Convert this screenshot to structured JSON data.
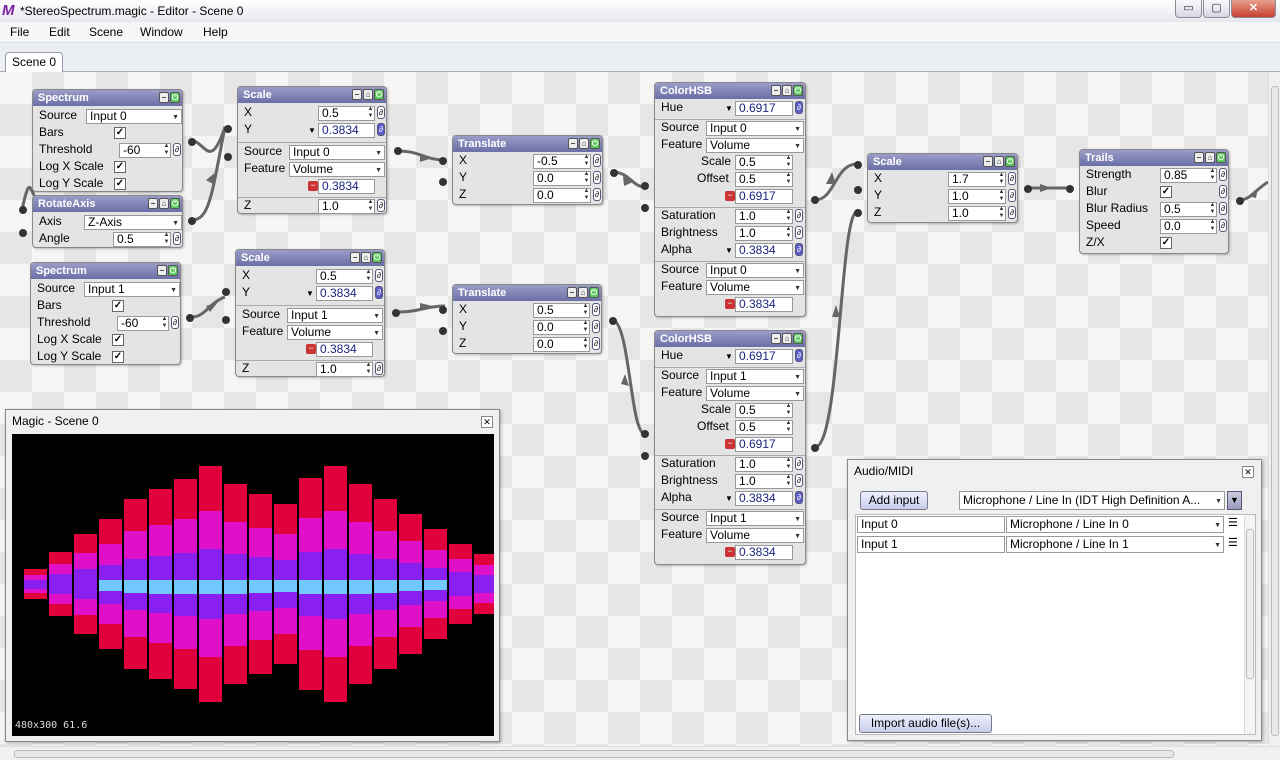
{
  "window": {
    "app_icon": "M",
    "title": "*StereoSpectrum.magic - Editor - Scene 0",
    "min_icon": "▭",
    "max_icon": "▢",
    "close_icon": "✕"
  },
  "menu": [
    "File",
    "Edit",
    "Scene",
    "Window",
    "Help"
  ],
  "tab": "Scene 0",
  "nodes": {
    "spectrum0": {
      "title": "Spectrum",
      "source_label": "Source",
      "source": "Input 0",
      "bars_label": "Bars",
      "threshold_label": "Threshold",
      "threshold": "-60",
      "logx_label": "Log X Scale",
      "logy_label": "Log Y Scale"
    },
    "rotate": {
      "title": "RotateAxis",
      "axis_label": "Axis",
      "axis": "Z-Axis",
      "angle_label": "Angle",
      "angle": "0.5"
    },
    "spectrum1": {
      "title": "Spectrum",
      "source_label": "Source",
      "source": "Input 1",
      "bars_label": "Bars",
      "threshold_label": "Threshold",
      "threshold": "-60",
      "logx_label": "Log X Scale",
      "logy_label": "Log Y Scale"
    },
    "scale0": {
      "title": "Scale",
      "x_label": "X",
      "x": "0.5",
      "y_label": "Y",
      "y": "0.3834",
      "source_label": "Source",
      "source": "Input 0",
      "feature_label": "Feature",
      "feature": "Volume",
      "value": "0.3834",
      "z_label": "Z",
      "z": "1.0"
    },
    "scale1": {
      "title": "Scale",
      "x_label": "X",
      "x": "0.5",
      "y_label": "Y",
      "y": "0.3834",
      "source_label": "Source",
      "source": "Input 1",
      "feature_label": "Feature",
      "feature": "Volume",
      "value": "0.3834",
      "z_label": "Z",
      "z": "1.0"
    },
    "translate0": {
      "title": "Translate",
      "x_label": "X",
      "x": "-0.5",
      "y_label": "Y",
      "y": "0.0",
      "z_label": "Z",
      "z": "0.0"
    },
    "translate1": {
      "title": "Translate",
      "x_label": "X",
      "x": "0.5",
      "y_label": "Y",
      "y": "0.0",
      "z_label": "Z",
      "z": "0.0"
    },
    "colorhsb0": {
      "title": "ColorHSB",
      "hue_label": "Hue",
      "hue": "0.6917",
      "source_label": "Source",
      "source": "Input 0",
      "feature_label": "Feature",
      "feature": "Volume",
      "scale_label": "Scale",
      "scale": "0.5",
      "offset_label": "Offset",
      "offset": "0.5",
      "value": "0.6917",
      "sat_label": "Saturation",
      "sat": "1.0",
      "bright_label": "Brightness",
      "bright": "1.0",
      "alpha_label": "Alpha",
      "alpha": "0.3834",
      "source2": "Input 0",
      "feature2": "Volume",
      "value2": "0.3834"
    },
    "colorhsb1": {
      "title": "ColorHSB",
      "hue_label": "Hue",
      "hue": "0.6917",
      "source_label": "Source",
      "source": "Input 1",
      "feature_label": "Feature",
      "feature": "Volume",
      "scale_label": "Scale",
      "scale": "0.5",
      "offset_label": "Offset",
      "offset": "0.5",
      "value": "0.6917",
      "sat_label": "Saturation",
      "sat": "1.0",
      "bright_label": "Brightness",
      "bright": "1.0",
      "alpha_label": "Alpha",
      "alpha": "0.3834",
      "source2": "Input 1",
      "feature2": "Volume",
      "value2": "0.3834"
    },
    "scale2": {
      "title": "Scale",
      "x_label": "X",
      "x": "1.7",
      "y_label": "Y",
      "y": "1.0",
      "z_label": "Z",
      "z": "1.0"
    },
    "trails": {
      "title": "Trails",
      "strength_label": "Strength",
      "strength": "0.85",
      "blur_label": "Blur",
      "blurr_label": "Blur Radius",
      "blurr": "0.5",
      "speed_label": "Speed",
      "speed": "0.0",
      "zx_label": "Z/X"
    }
  },
  "preview": {
    "title": "Magic - Scene 0",
    "status": "480x300 61.6",
    "close_icon": "✕"
  },
  "audio": {
    "title": "Audio/MIDI",
    "add_input": "Add input",
    "device": "Microphone / Line In (IDT High Definition A...",
    "inputs": [
      {
        "name": "Input 0",
        "channel": "Microphone / Line In 0"
      },
      {
        "name": "Input 1",
        "channel": "Microphone / Line In 1"
      }
    ],
    "import": "Import audio file(s)...",
    "close_icon": "✕"
  },
  "colors": {
    "node_header": "#6c6fa6",
    "wire": "#666666",
    "bar_red": "#e0003c",
    "bar_magenta": "#e010c8",
    "bar_violet": "#8a20f0",
    "bar_cyan": "#70c8ff"
  }
}
